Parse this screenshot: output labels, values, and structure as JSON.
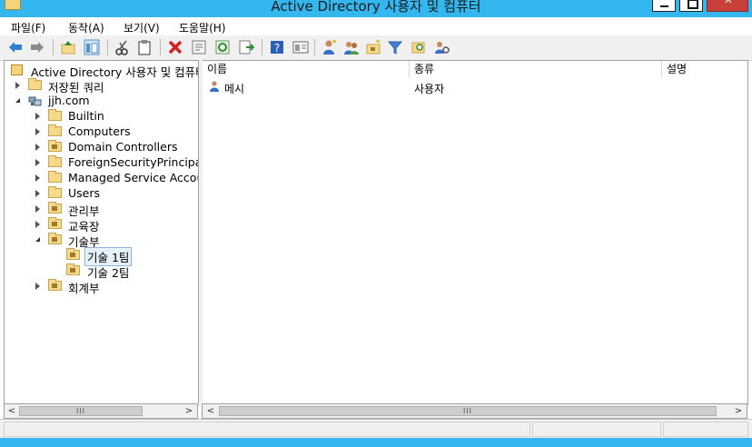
{
  "window": {
    "title": "Active Directory 사용자 및 컴퓨터"
  },
  "menu": [
    {
      "label": "파일(F)"
    },
    {
      "label": "동작(A)"
    },
    {
      "label": "보기(V)"
    },
    {
      "label": "도움말(H)"
    }
  ],
  "toolbar": {
    "buttons": [
      "back-icon",
      "forward-icon",
      "up-folder-icon",
      "show-console-tree-icon",
      "cut-icon",
      "paste-icon",
      "delete-icon",
      "properties-icon",
      "refresh-icon",
      "export-list-icon",
      "help-icon",
      "view-icon",
      "new-user-icon",
      "new-group-icon",
      "new-ou-icon",
      "filter-icon",
      "find-icon",
      "add-to-group-icon"
    ]
  },
  "tree": {
    "root": "Active Directory 사용자 및 컴퓨터",
    "saved_queries": "저장된 쿼리",
    "domain": "jjh.com",
    "nodes": [
      {
        "label": "Builtin"
      },
      {
        "label": "Computers"
      },
      {
        "label": "Domain Controllers"
      },
      {
        "label": "ForeignSecurityPrincipals"
      },
      {
        "label": "Managed Service Accounts"
      },
      {
        "label": "Users"
      },
      {
        "label": "관리부"
      },
      {
        "label": "교육장"
      },
      {
        "label": "기술부"
      },
      {
        "label": "기술 1팀"
      },
      {
        "label": "기술 2팀"
      },
      {
        "label": "회계부"
      }
    ]
  },
  "list": {
    "columns": [
      {
        "label": "이름"
      },
      {
        "label": "종류"
      },
      {
        "label": "설명"
      }
    ],
    "rows": [
      {
        "name": "메시",
        "type": "사용자",
        "description": ""
      }
    ]
  },
  "scrollbar": {
    "left_arrow": "<",
    "right_arrow": ">",
    "thumb_grip": "III"
  },
  "colors": {
    "titlebar": "#33b7ee",
    "close_button": "#c7413a",
    "folder": "#f6d98a",
    "selection": "#e5f1fb"
  }
}
